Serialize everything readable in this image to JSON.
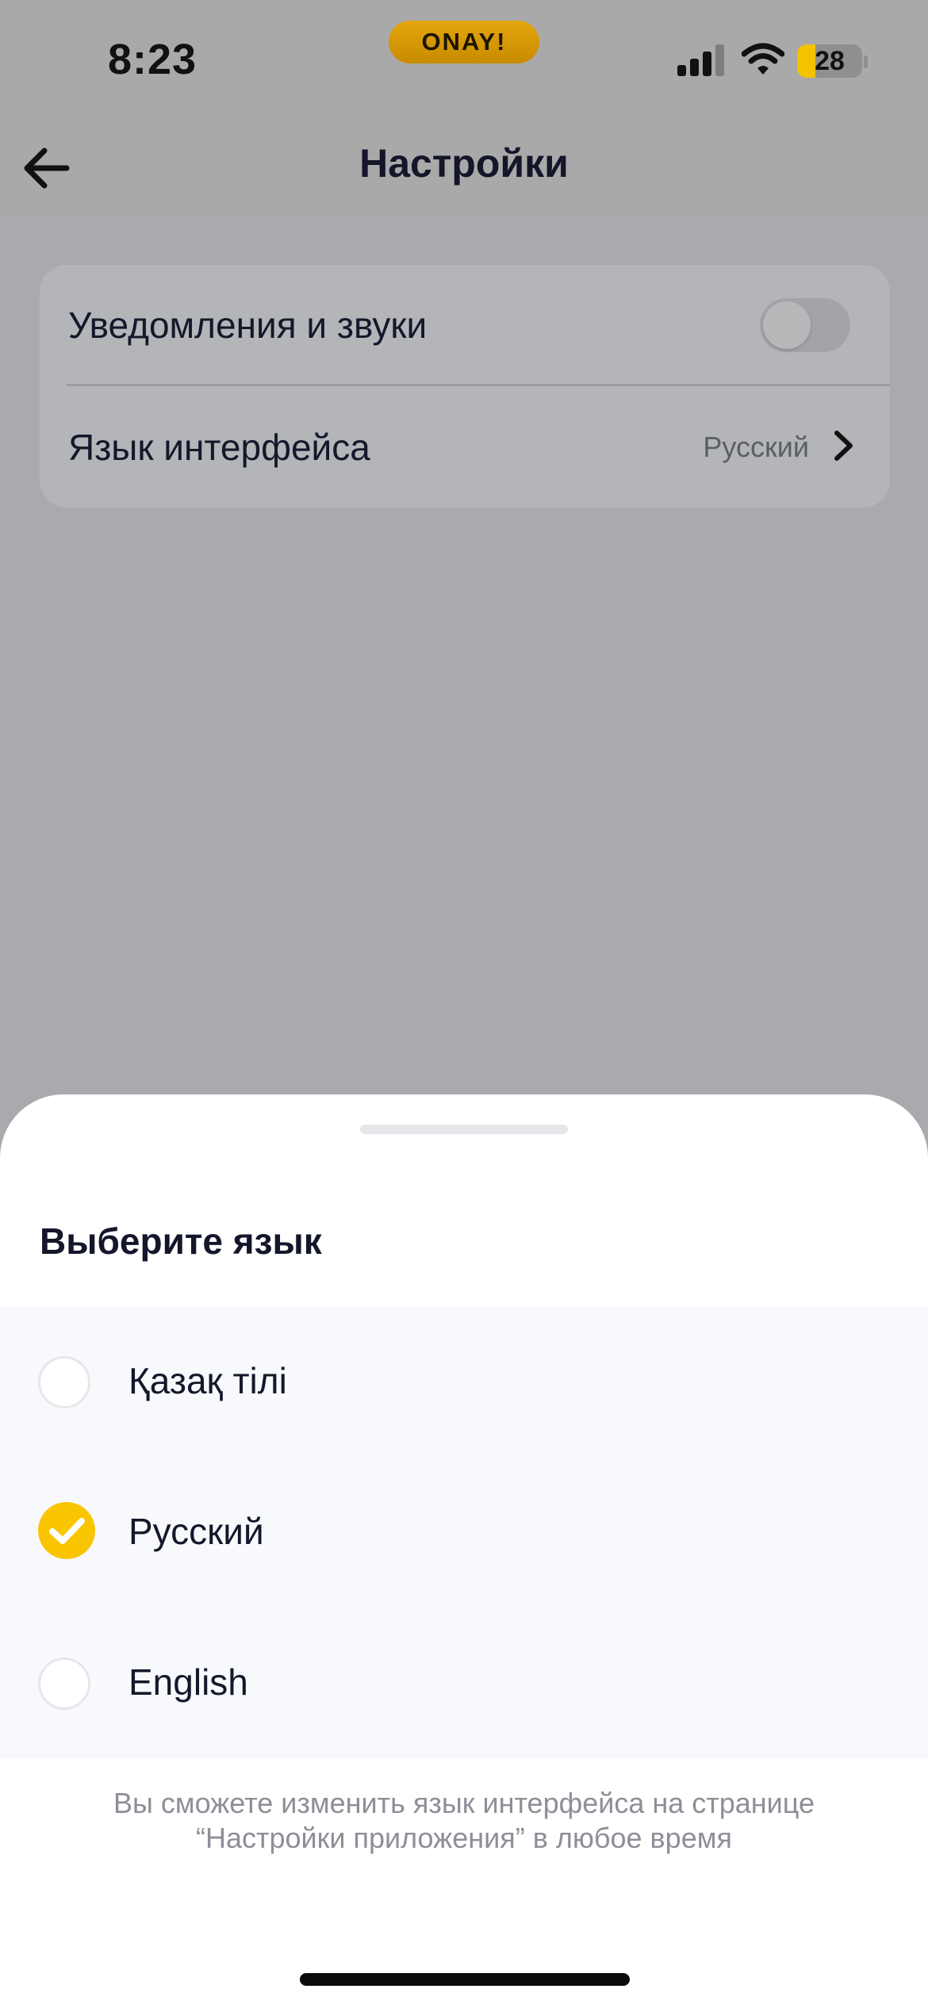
{
  "status_bar": {
    "time": "8:23",
    "island_label": "ONAY!",
    "battery_percent": 28,
    "icons": [
      "signal-icon",
      "wifi-icon",
      "battery-icon"
    ]
  },
  "nav": {
    "back_icon": "arrow-left-icon",
    "title": "Настройки"
  },
  "settings": {
    "notifications": {
      "label": "Уведомления и звуки",
      "enabled": false
    },
    "language": {
      "label": "Язык интерфейса",
      "value": "Русский",
      "icon": "chevron-right-icon"
    }
  },
  "sheet": {
    "title": "Выберите язык",
    "options": [
      {
        "label": "Қазақ тілі",
        "selected": false
      },
      {
        "label": "Русский",
        "selected": true
      },
      {
        "label": "English",
        "selected": false
      }
    ],
    "footnote": "Вы сможете изменить язык интерфейса на странице “Настройки приложения” в любое время"
  },
  "colors": {
    "accent": "#F8C500",
    "overlay": "#A9AAAD",
    "text": "#15172B",
    "muted_text": "#8D8F98"
  }
}
